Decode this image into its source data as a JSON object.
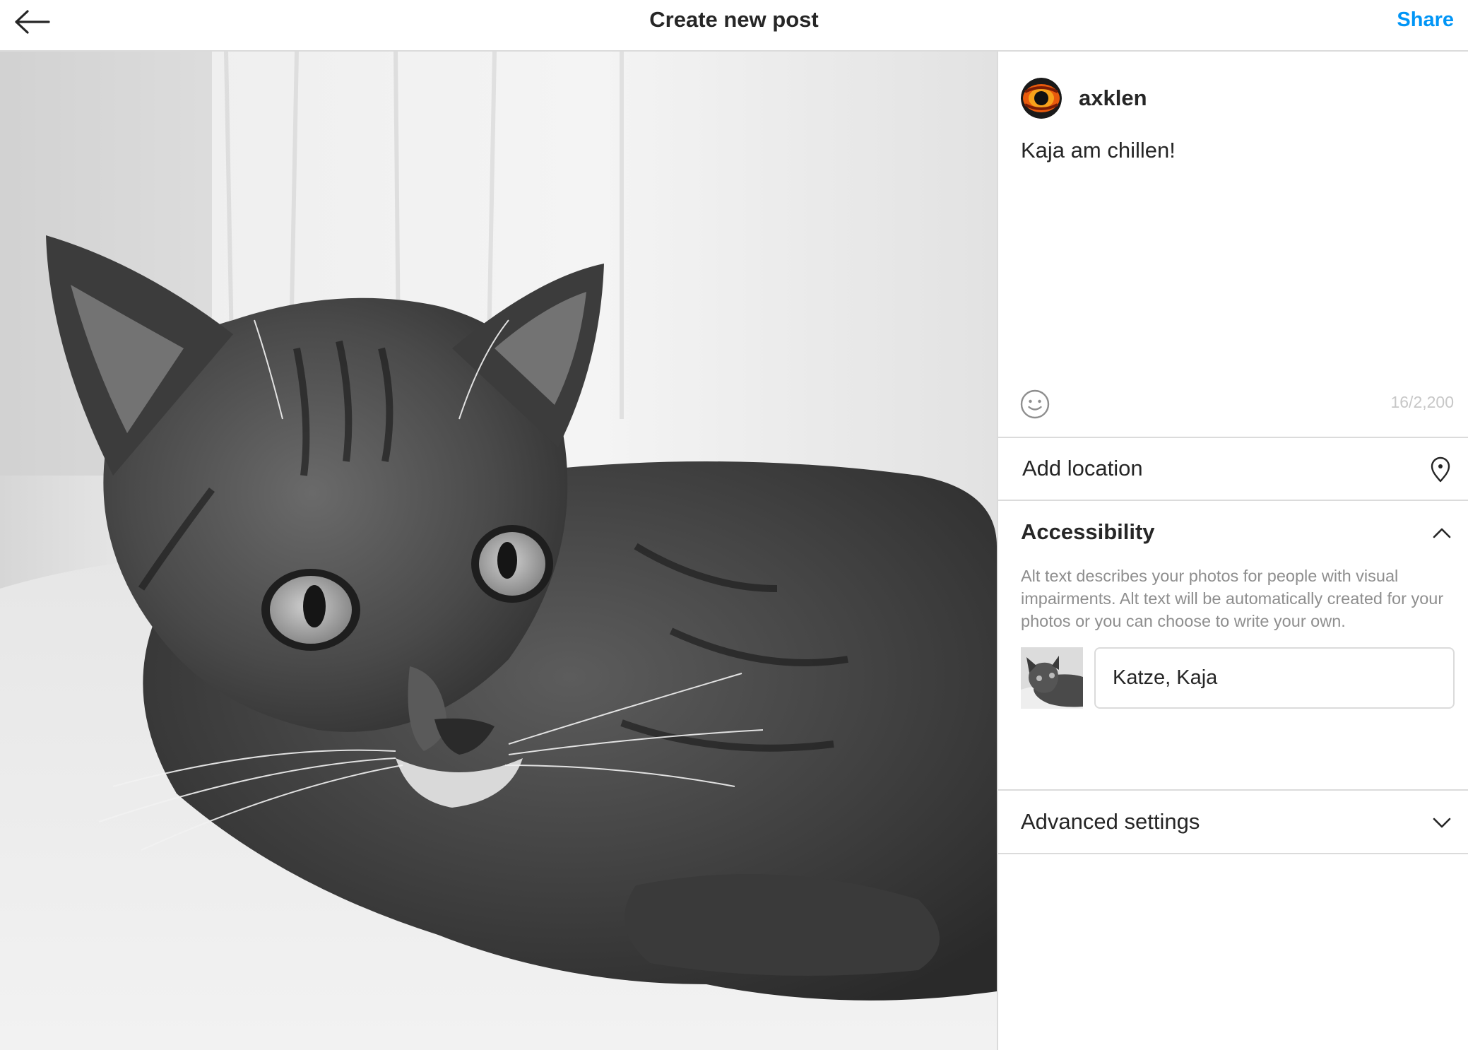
{
  "header": {
    "title": "Create new post",
    "back_icon": "arrow-left-icon",
    "share_label": "Share",
    "share_color": "#0095f6"
  },
  "photo": {
    "style": "black-and-white"
  },
  "composer": {
    "username": "axklen",
    "caption": "Kaja am chillen!",
    "emoji_icon": "smiley-icon",
    "char_count": "16/2,200"
  },
  "location": {
    "label": "Add location",
    "icon": "location-pin-icon"
  },
  "accessibility": {
    "title": "Accessibility",
    "expanded": true,
    "description": "Alt text describes your photos for people with visual impairments. Alt text will be automatically created for your photos or you can choose to write your own.",
    "alt_text_value": "Katze, Kaja",
    "chevron_icon": "chevron-up-icon"
  },
  "advanced": {
    "label": "Advanced settings",
    "expanded": false,
    "chevron_icon": "chevron-down-icon"
  },
  "colors": {
    "accent": "#0095f6",
    "border": "#dbdbdb",
    "text": "#262626",
    "muted": "#8e8e8e"
  }
}
